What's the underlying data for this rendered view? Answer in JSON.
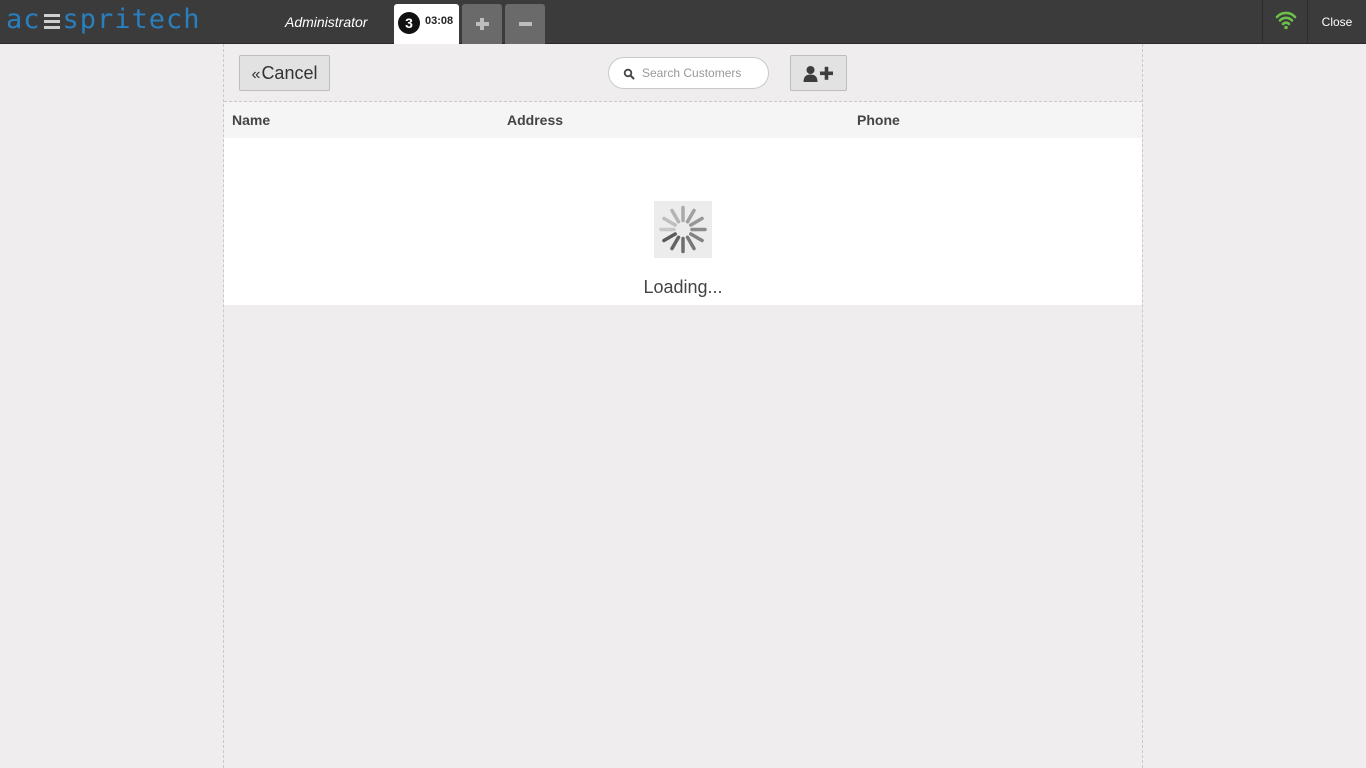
{
  "topbar": {
    "logo_left": "ac",
    "logo_right": "spritech",
    "user_label": "Administrator",
    "order_tab": {
      "count": "3",
      "time": "03:08"
    },
    "close_label": "Close",
    "colors": {
      "bar": "#3b3b3b",
      "logo": "#2a7fbf",
      "wifi": "#6cc04a"
    }
  },
  "toolbar": {
    "cancel_label": "Cancel",
    "search": {
      "placeholder": "Search Customers",
      "value": ""
    },
    "add_customer_icon": "add-user-icon"
  },
  "table": {
    "columns": [
      "Name",
      "Address",
      "Phone"
    ],
    "rows": []
  },
  "loading": {
    "text": "Loading..."
  }
}
